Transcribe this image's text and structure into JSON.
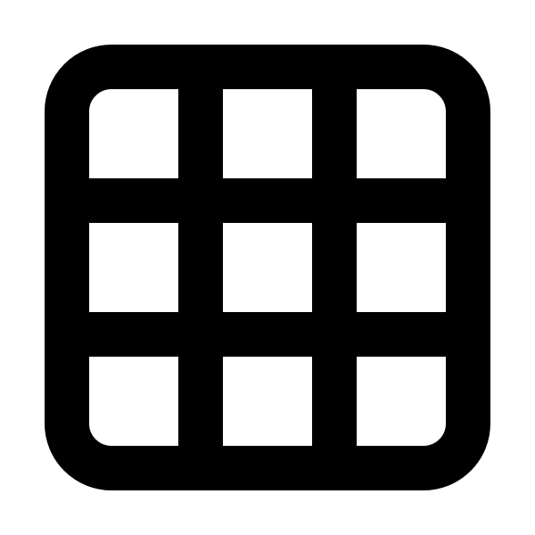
{
  "icon": {
    "name": "grid-icon",
    "rows": 3,
    "columns": 3,
    "color": "#000000",
    "background": "#ffffff"
  }
}
